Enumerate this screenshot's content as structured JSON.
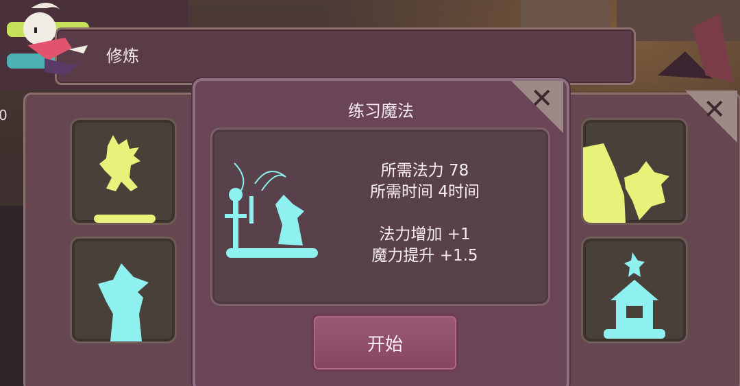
{
  "header": {
    "title": "修炼"
  },
  "dialog": {
    "title": "练习魔法",
    "info": {
      "mana_cost": "所需法力 78",
      "time_cost": "所需时间 4时间",
      "mana_increase": "法力增加 +1",
      "magic_boost": "魔力提升 +1.5"
    },
    "start_label": "开始"
  },
  "left_hud": {
    "partial_value": "0"
  },
  "colors": {
    "panel": "#664650",
    "dialog": "#6a4556",
    "button": "#8f4f69",
    "icon_yellow": "#e8f27a",
    "icon_cyan": "#8ff0f0"
  },
  "icons": {
    "left_top": "running-character-icon",
    "left_bottom": "witch-silhouette-icon",
    "right_top": "tree-witch-icon",
    "right_bottom": "house-icon",
    "dialog_illustration": "magic-practice-icon"
  }
}
